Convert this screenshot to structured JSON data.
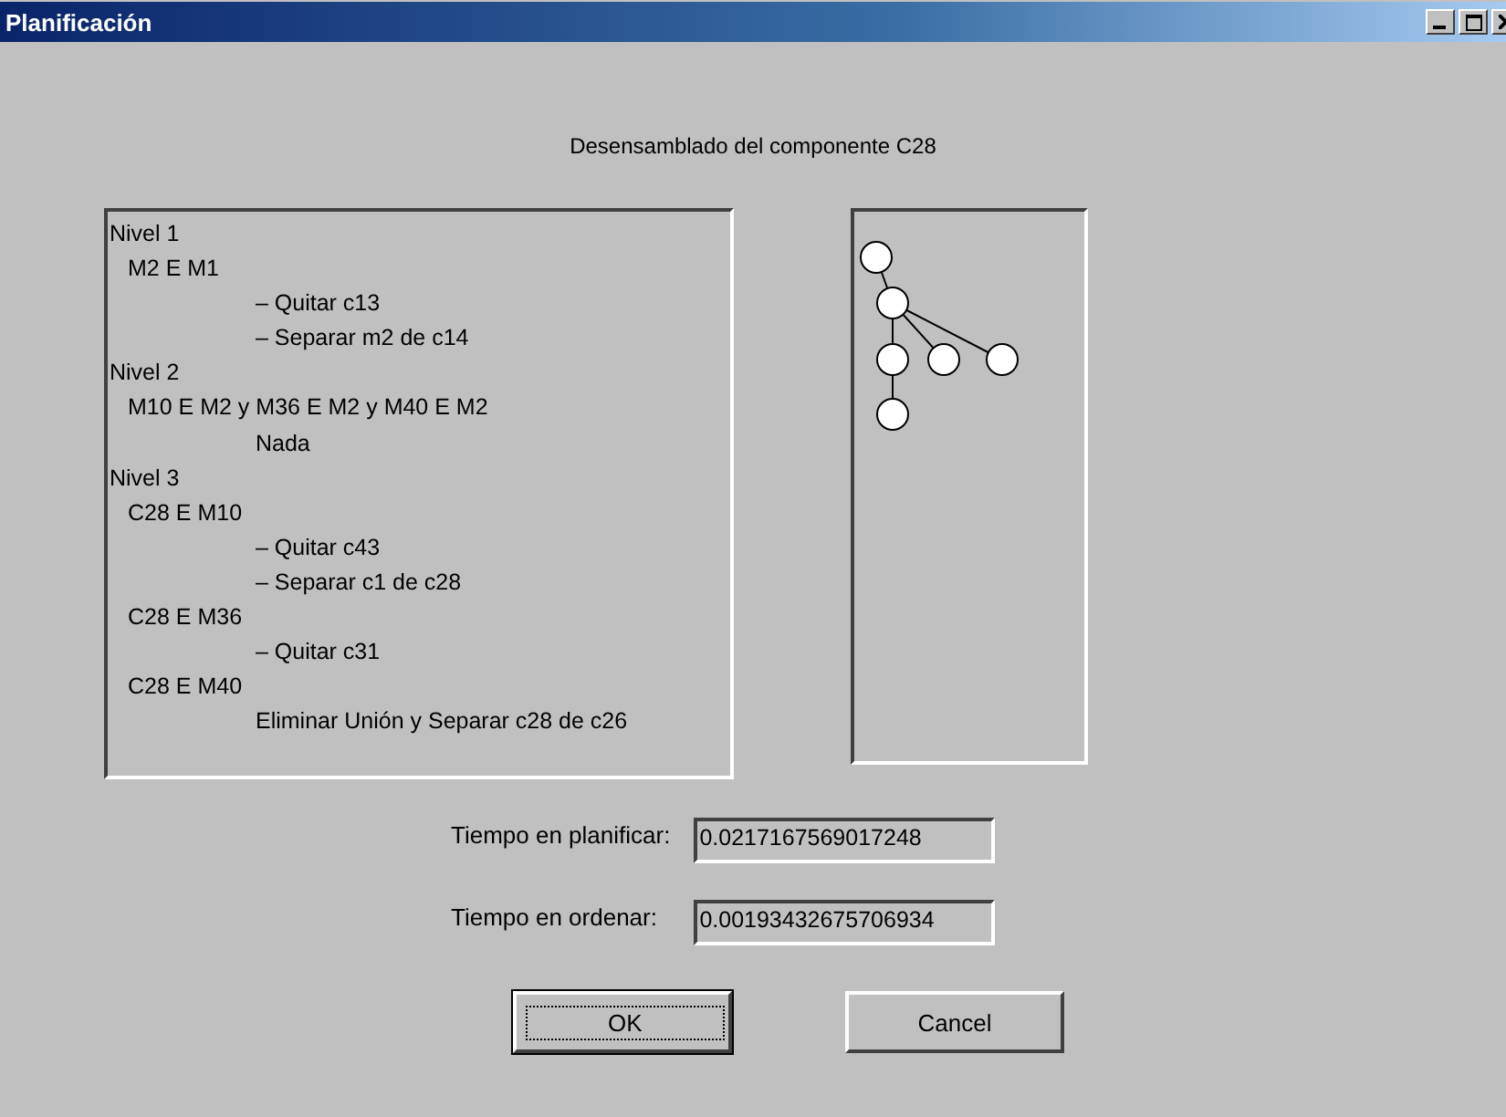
{
  "window": {
    "title": "Planificación"
  },
  "heading": "Desensamblado del componente C28",
  "plan": [
    {
      "title": "Nivel 1",
      "children": [
        {
          "text": "M2 E M1",
          "children": [
            {
              "text": "– Quitar c13"
            },
            {
              "text": "– Separar m2 de c14"
            }
          ]
        }
      ]
    },
    {
      "title": "Nivel 2",
      "children": [
        {
          "text": "M10 E M2 y M36 E M2 y M40 E M2",
          "children": [
            {
              "text": "Nada"
            }
          ]
        }
      ]
    },
    {
      "title": "Nivel 3",
      "children": [
        {
          "text": "C28 E M10",
          "children": [
            {
              "text": "– Quitar c43"
            },
            {
              "text": "– Separar c1 de c28"
            }
          ]
        },
        {
          "text": "C28 E M36",
          "children": [
            {
              "text": "– Quitar c31"
            }
          ]
        },
        {
          "text": "C28 E M40",
          "children": [
            {
              "text": "Eliminar Unión y Separar c28 de c26"
            }
          ]
        }
      ]
    }
  ],
  "fields": [
    {
      "label": "Tiempo en planificar:",
      "value": "0.0217167569017248"
    },
    {
      "label": "Tiempo en ordenar:",
      "value": "0.00193432675706934"
    }
  ],
  "buttons": [
    {
      "label": "OK",
      "default": true
    },
    {
      "label": "Cancel",
      "default": false
    }
  ]
}
